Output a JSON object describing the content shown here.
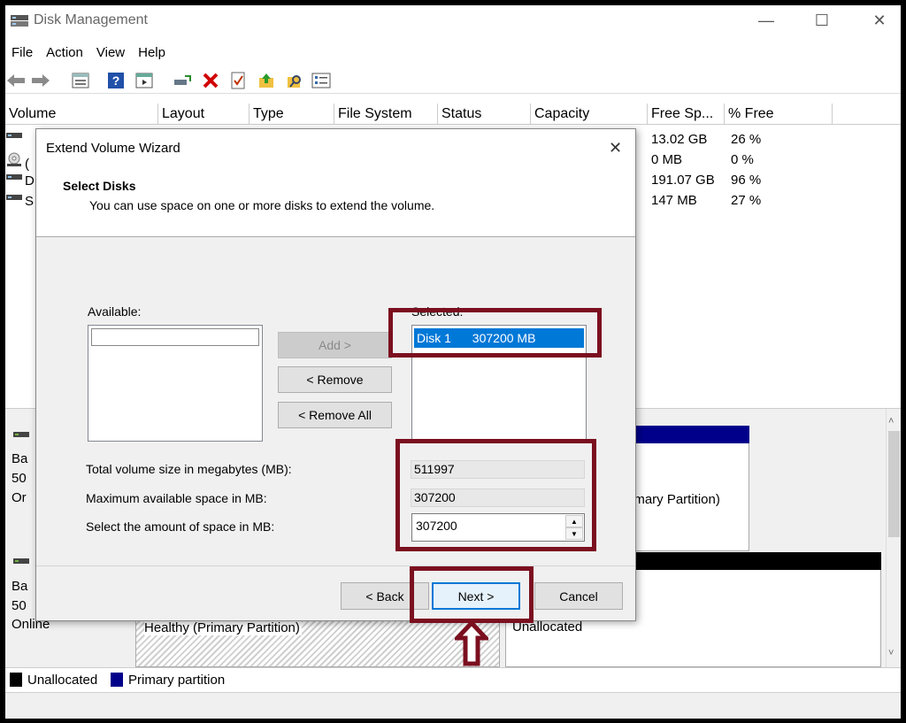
{
  "window": {
    "title": "Disk Management",
    "min": "—",
    "max": "☐",
    "close": "✕"
  },
  "menu": [
    "File",
    "Action",
    "View",
    "Help"
  ],
  "columns": [
    "Volume",
    "Layout",
    "Type",
    "File System",
    "Status",
    "Capacity",
    "Free Sp...",
    "% Free"
  ],
  "volumes": [
    {
      "stub": "",
      "free": "13.02 GB",
      "pct": "26 %"
    },
    {
      "stub": "(",
      "free": "0 MB",
      "pct": "0 %"
    },
    {
      "stub": "D",
      "free": "191.07 GB",
      "pct": "96 %"
    },
    {
      "stub": "S",
      "free": "147 MB",
      "pct": "27 %"
    }
  ],
  "disks": {
    "disk0": {
      "line1": "Ba",
      "line2": "50",
      "line3": "Or",
      "partition_status": "imary Partition)"
    },
    "disk1": {
      "line1": "Ba",
      "line2": "50",
      "line3": "Online",
      "partition1_status": "Healthy (Primary Partition)",
      "partition2_status": "Unallocated"
    }
  },
  "legend": {
    "unallocated": "Unallocated",
    "primary": "Primary partition",
    "unallocated_color": "#000000",
    "primary_color": "#00008b"
  },
  "dialog": {
    "title": "Extend Volume Wizard",
    "close": "✕",
    "heading": "Select Disks",
    "description": "You can use space on one or more disks to extend the volume.",
    "available_label": "Available:",
    "selected_label": "Selected:",
    "selected_disk": "Disk 1",
    "selected_size": "307200 MB",
    "add_button": "Add >",
    "remove_button": "< Remove",
    "remove_all_button": "< Remove All",
    "total_label": "Total volume size in megabytes (MB):",
    "total_value": "511997",
    "max_label": "Maximum available space in MB:",
    "max_value": "307200",
    "select_label": "Select the amount of space in MB:",
    "select_value": "307200",
    "back_button": "< Back",
    "next_button": "Next >",
    "cancel_button": "Cancel"
  },
  "colors": {
    "highlight": "#7b0f1f",
    "selection": "#0078d7",
    "primary_bar": "#00008b"
  }
}
